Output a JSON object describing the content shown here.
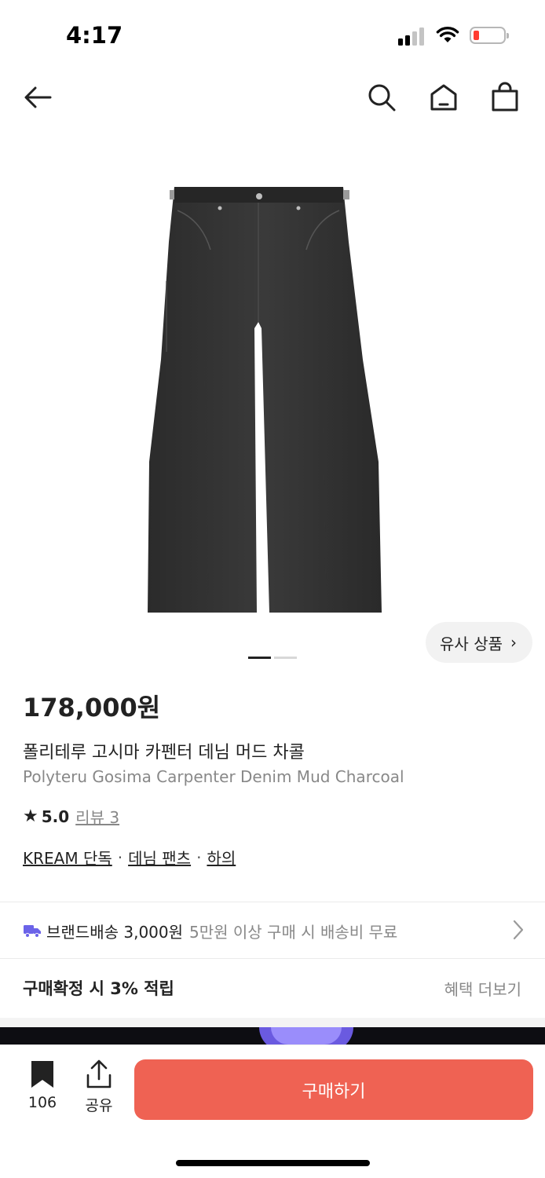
{
  "status": {
    "time": "4:17"
  },
  "header": {
    "back_icon": "arrow-left-icon",
    "search_icon": "search-icon",
    "home_icon": "home-icon",
    "bag_icon": "shopping-bag-icon"
  },
  "gallery": {
    "similar_label": "유사 상품",
    "similar_chevron": "›",
    "pages_total": 2,
    "page_current": 1
  },
  "product": {
    "price": "178,000원",
    "name_ko": "폴리테루 고시마 카펜터 데님 머드 차콜",
    "name_en": "Polyteru Gosima Carpenter Denim Mud Charcoal",
    "rating_star": "★",
    "rating": "5.0",
    "review": "리뷰 3",
    "categories": [
      "KREAM 단독",
      "데님 팬츠",
      "하의"
    ],
    "category_sep": "·"
  },
  "delivery": {
    "brand_ship": "브랜드배송 3,000원",
    "free_ship": "5만원 이상 구매 시 배송비 무료"
  },
  "points": {
    "label": "구매확정 시 3% 적립",
    "more": "혜택 더보기"
  },
  "bottom": {
    "bookmark_count": "106",
    "share_label": "공유",
    "buy_label": "구매하기"
  },
  "colors": {
    "accent": "#ef6253",
    "truck": "#6b63e8",
    "text": "#222222",
    "muted": "#888888"
  }
}
